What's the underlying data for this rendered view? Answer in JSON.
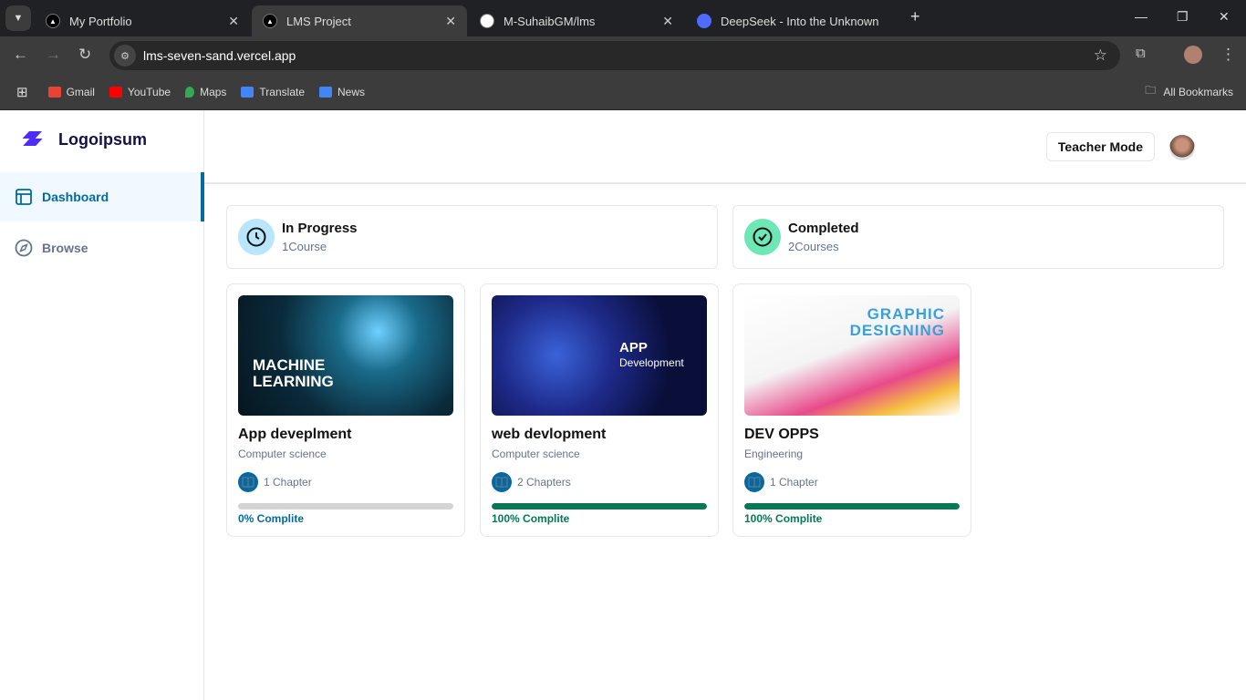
{
  "browser": {
    "tabs": [
      {
        "title": "My Portfolio",
        "icon": "vercel-icon"
      },
      {
        "title": "LMS Project",
        "icon": "vercel-icon",
        "active": true
      },
      {
        "title": "M-SuhaibGM/lms",
        "icon": "github-icon"
      },
      {
        "title": "DeepSeek - Into the Unknown",
        "icon": "deepseek-icon"
      }
    ],
    "url": "lms-seven-sand.vercel.app",
    "bookmarks": [
      {
        "label": "Gmail",
        "color": "#ea4335"
      },
      {
        "label": "YouTube",
        "color": "#ff0000"
      },
      {
        "label": "Maps",
        "color": "#34a853"
      },
      {
        "label": "Translate",
        "color": "#4285f4"
      },
      {
        "label": "News",
        "color": "#4285f4"
      }
    ],
    "all_bookmarks": "All Bookmarks"
  },
  "sidebar": {
    "logo": "Logoipsum",
    "items": [
      {
        "label": "Dashboard",
        "icon": "layout-icon",
        "active": true
      },
      {
        "label": "Browse",
        "icon": "compass-icon"
      }
    ]
  },
  "header": {
    "teacher_mode": "Teacher Mode"
  },
  "stats": [
    {
      "title": "In Progress",
      "subtitle": "1Course",
      "color": "#bae6fd"
    },
    {
      "title": "Completed",
      "subtitle": "2Courses",
      "color": "#6ee7b7"
    }
  ],
  "courses": [
    {
      "title": "App deveplment",
      "category": "Computer science",
      "chapters": "1 Chapter",
      "progress": 0,
      "progress_label": "0% Complite",
      "image_text": [
        "MACHINE",
        "LEARNING"
      ]
    },
    {
      "title": "web devlopment",
      "category": "Computer science",
      "chapters": "2 Chapters",
      "progress": 100,
      "progress_label": "100% Complite",
      "image_text": [
        "APP",
        "Development"
      ]
    },
    {
      "title": "DEV OPPS",
      "category": "Engineering",
      "chapters": "1 Chapter",
      "progress": 100,
      "progress_label": "100% Complite",
      "image_text": [
        "GRAPHIC",
        "DESIGNING"
      ]
    }
  ]
}
